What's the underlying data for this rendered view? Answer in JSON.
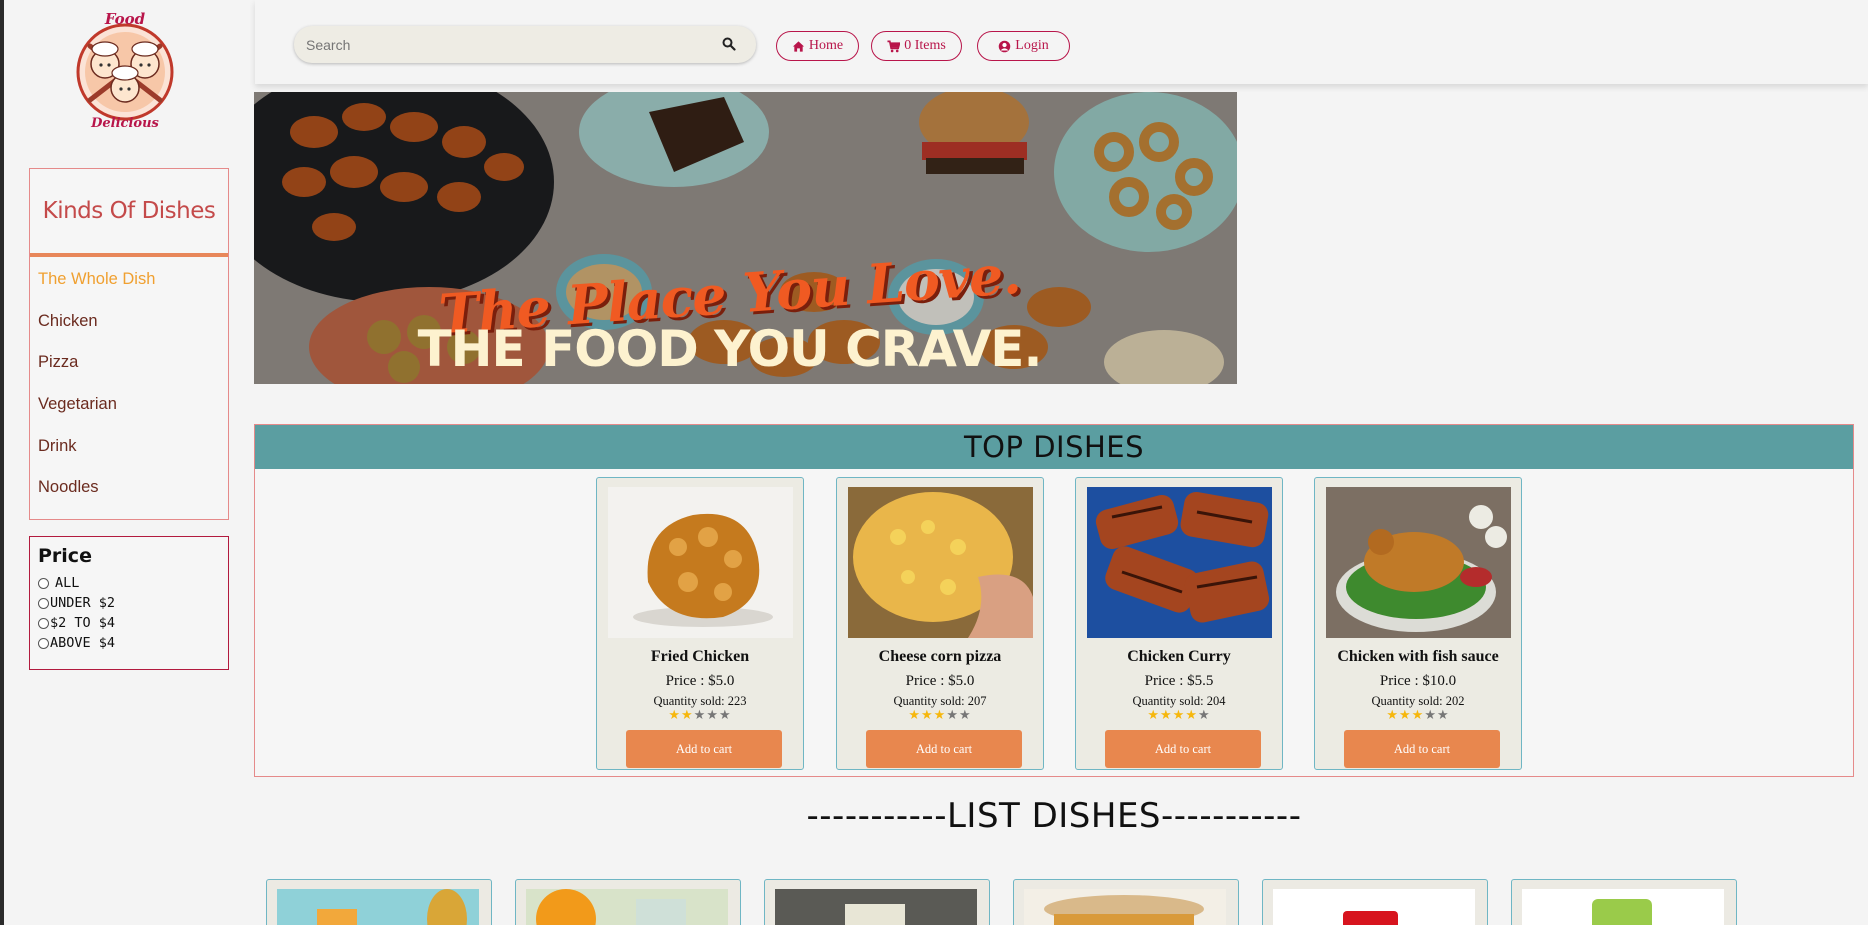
{
  "header": {
    "logo_alt": "Food Delicious",
    "search_placeholder": "Search",
    "nav": [
      {
        "label": "Home",
        "icon": "home-icon"
      },
      {
        "label": "0 Items",
        "icon": "cart-icon"
      },
      {
        "label": "Login",
        "icon": "user-icon"
      }
    ]
  },
  "sidebar": {
    "title": "Kinds Of Dishes",
    "items": [
      {
        "label": "The Whole Dish",
        "active": true
      },
      {
        "label": "Chicken"
      },
      {
        "label": "Pizza"
      },
      {
        "label": "Vegetarian"
      },
      {
        "label": "Drink"
      },
      {
        "label": "Noodles"
      }
    ],
    "price_title": "Price",
    "price_options": [
      "ALL",
      "UNDER $2",
      "$2 TO $4",
      "ABOVE $4"
    ]
  },
  "banner": {
    "line1": "The Place You Love.",
    "line2": "THE FOOD YOU CRAVE."
  },
  "top_dishes": {
    "title": "TOP DISHES",
    "items": [
      {
        "name": "Fried Chicken",
        "price": "Price : $5.0",
        "sold": "Quantity sold: 223",
        "rating": 2,
        "button": "Add to cart"
      },
      {
        "name": "Cheese corn pizza",
        "price": "Price : $5.0",
        "sold": "Quantity sold: 207",
        "rating": 3,
        "button": "Add to cart"
      },
      {
        "name": "Chicken Curry",
        "price": "Price : $5.5",
        "sold": "Quantity sold: 204",
        "rating": 4,
        "button": "Add to cart"
      },
      {
        "name": "Chicken with fish sauce",
        "price": "Price : $10.0",
        "sold": "Quantity sold: 202",
        "rating": 3,
        "button": "Add to cart"
      }
    ]
  },
  "list_dishes": {
    "title": "-----------LIST DISHES-----------"
  },
  "colors": {
    "accent": "#b8154a",
    "teal_header": "#5b9ea1",
    "button_orange": "#e8874e",
    "active_item": "#f0a030",
    "star": "#f6b70d"
  }
}
